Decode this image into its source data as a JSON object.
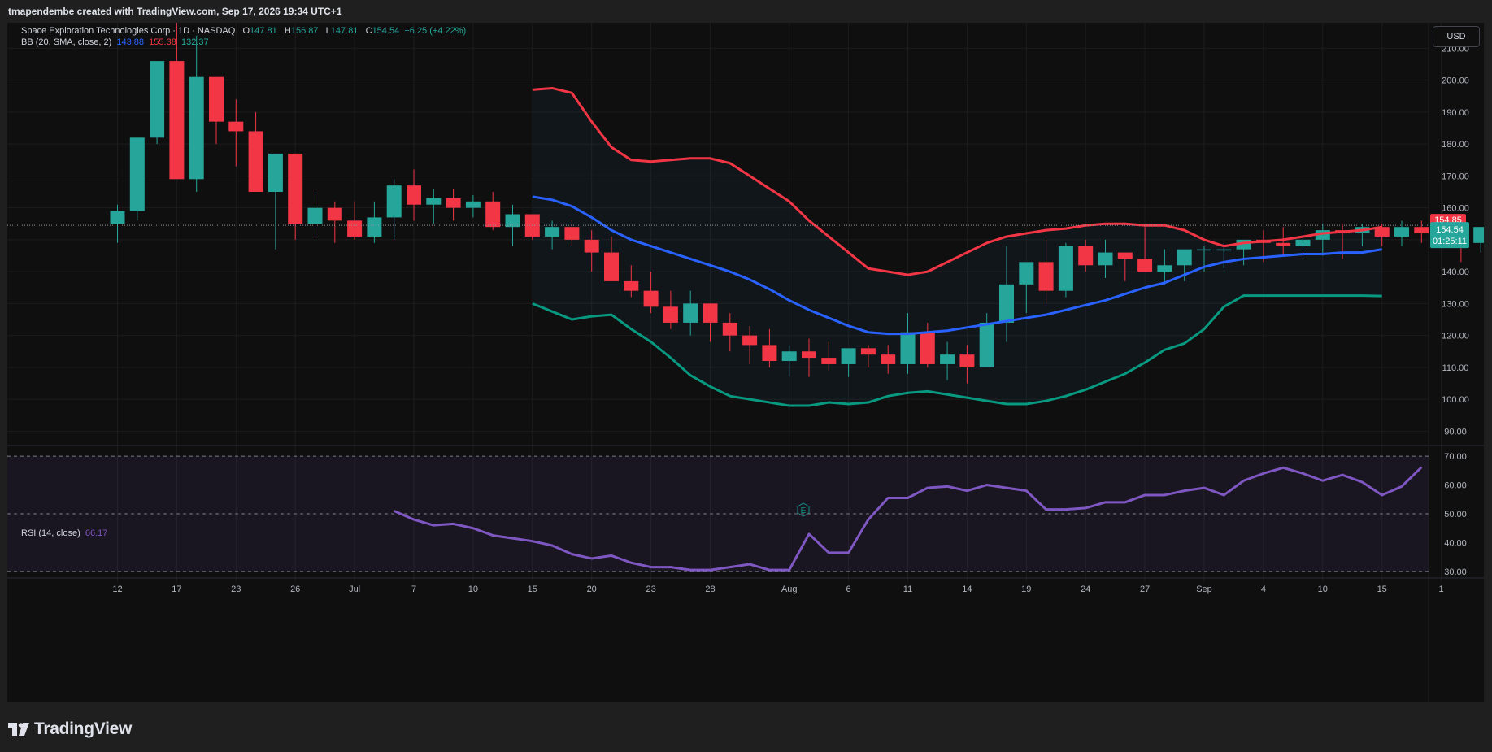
{
  "header": {
    "credit": "tmapendembe created with TradingView.com, Sep 17, 2026 19:34 UTC+1"
  },
  "legend": {
    "symbol": "Space Exploration Technologies Corp · 1D · NASDAQ",
    "o_label": "O",
    "o": "147.81",
    "h_label": "H",
    "h": "156.87",
    "l_label": "L",
    "l": "147.81",
    "c_label": "C",
    "c": "154.54",
    "change": "+6.25 (+4.22%)",
    "bb_label": "BB (20, SMA, close, 2)",
    "bb_basis": "143.88",
    "bb_upper": "155.38",
    "bb_lower": "132.37",
    "rsi_label": "RSI (14, close)",
    "rsi_value": "66.17"
  },
  "currency_button": "USD",
  "footer": {
    "brand": "TradingView",
    "logo_icon": "tradingview-logo-icon"
  },
  "colors": {
    "up": "#26a69a",
    "down": "#f23645",
    "bb_basis": "#2962ff",
    "bb_upper": "#f23645",
    "bb_lower": "#089981",
    "rsi": "#7e57c2"
  },
  "price_tags": {
    "upper": "154.85",
    "last": "154.54",
    "countdown": "01:25:11"
  },
  "earnings_marker": "E",
  "chart_data": [
    {
      "type": "candlestick",
      "title": "Space Exploration Technologies Corp · 1D · NASDAQ",
      "ylim": [
        85,
        218
      ],
      "y_ticks": [
        90,
        100,
        110,
        120,
        130,
        140,
        150,
        160,
        170,
        180,
        190,
        200,
        210
      ],
      "y_tick_labels": [
        "90.00",
        "100.00",
        "110.00",
        "120.00",
        "130.00",
        "140.00",
        "150.00",
        "160.00",
        "170.00",
        "180.00",
        "190.00",
        "200.00",
        "210.00"
      ],
      "x_tick_labels": [
        {
          "label": "12",
          "i": 0
        },
        {
          "label": "17",
          "i": 3
        },
        {
          "label": "23",
          "i": 6
        },
        {
          "label": "26",
          "i": 9
        },
        {
          "label": "Jul",
          "i": 12
        },
        {
          "label": "7",
          "i": 15
        },
        {
          "label": "10",
          "i": 18
        },
        {
          "label": "15",
          "i": 21
        },
        {
          "label": "20",
          "i": 24
        },
        {
          "label": "23",
          "i": 27
        },
        {
          "label": "28",
          "i": 30
        },
        {
          "label": "Aug",
          "i": 34
        },
        {
          "label": "6",
          "i": 37
        },
        {
          "label": "11",
          "i": 40
        },
        {
          "label": "14",
          "i": 43
        },
        {
          "label": "19",
          "i": 46
        },
        {
          "label": "24",
          "i": 49
        },
        {
          "label": "27",
          "i": 52
        },
        {
          "label": "Sep",
          "i": 55
        },
        {
          "label": "4",
          "i": 58
        },
        {
          "label": "10",
          "i": 61
        },
        {
          "label": "15",
          "i": 64
        },
        {
          "label": "1",
          "i": 67
        }
      ],
      "candles": [
        [
          155,
          161,
          149,
          159
        ],
        [
          159,
          177,
          156,
          182
        ],
        [
          182,
          193,
          180,
          206
        ],
        [
          206,
          218,
          200,
          169
        ],
        [
          169,
          214,
          165,
          201
        ],
        [
          201,
          201,
          180,
          187
        ],
        [
          187,
          194,
          173,
          184
        ],
        [
          184,
          190,
          170,
          165
        ],
        [
          165,
          176,
          147,
          177
        ],
        [
          177,
          177,
          150,
          155
        ],
        [
          155,
          165,
          151,
          160
        ],
        [
          160,
          162,
          149,
          156
        ],
        [
          156,
          162,
          150,
          151
        ],
        [
          151,
          162,
          149,
          157
        ],
        [
          157,
          169,
          150,
          167
        ],
        [
          167,
          172,
          156,
          161
        ],
        [
          161,
          166,
          155,
          163
        ],
        [
          163,
          166,
          156,
          160
        ],
        [
          160,
          164,
          157,
          162
        ],
        [
          162,
          165,
          153,
          154
        ],
        [
          154,
          161,
          148,
          158
        ],
        [
          158,
          158,
          150,
          151
        ],
        [
          151,
          156,
          147,
          154
        ],
        [
          154,
          156,
          148,
          150
        ],
        [
          150,
          153,
          140,
          146
        ],
        [
          146,
          151,
          137,
          137
        ],
        [
          137,
          142,
          132,
          134
        ],
        [
          134,
          140,
          127,
          129
        ],
        [
          129,
          134,
          122,
          124
        ],
        [
          124,
          134,
          120,
          130
        ],
        [
          130,
          130,
          118,
          124
        ],
        [
          124,
          127,
          115,
          120
        ],
        [
          120,
          123,
          111,
          117
        ],
        [
          117,
          122,
          110,
          112
        ],
        [
          112,
          117,
          107,
          115
        ],
        [
          115,
          119,
          107,
          113
        ],
        [
          113,
          118,
          109,
          111
        ],
        [
          111,
          115,
          107,
          116
        ],
        [
          116,
          117,
          110,
          114
        ],
        [
          114,
          117,
          108,
          111
        ],
        [
          111,
          127,
          108,
          121
        ],
        [
          121,
          124,
          110,
          111
        ],
        [
          111,
          118,
          106,
          114
        ],
        [
          114,
          117,
          105,
          110
        ],
        [
          110,
          127,
          110,
          124
        ],
        [
          124,
          148,
          118,
          136
        ],
        [
          136,
          138,
          127,
          143
        ],
        [
          143,
          150,
          130,
          134
        ],
        [
          134,
          149,
          132,
          148
        ],
        [
          148,
          150,
          140,
          142
        ],
        [
          142,
          150,
          138,
          146
        ],
        [
          146,
          146,
          137,
          144
        ],
        [
          144,
          154,
          140,
          140
        ],
        [
          140,
          147,
          136,
          142
        ],
        [
          142,
          146,
          137,
          147
        ],
        [
          147,
          148,
          140,
          147
        ],
        [
          147,
          149,
          141,
          147
        ],
        [
          147,
          150,
          142,
          150
        ],
        [
          150,
          153,
          143,
          149
        ],
        [
          149,
          154,
          145,
          148
        ],
        [
          148,
          153,
          144,
          150
        ],
        [
          150,
          155,
          145,
          153
        ],
        [
          153,
          155,
          144,
          152
        ],
        [
          152,
          155,
          148,
          154
        ],
        [
          154,
          155,
          148,
          151
        ],
        [
          151,
          156,
          148,
          154
        ],
        [
          154,
          156,
          149,
          152
        ],
        [
          152,
          156,
          148,
          152
        ],
        [
          152,
          155,
          143,
          149
        ],
        [
          149,
          154,
          146,
          154
        ],
        [
          147.81,
          156.87,
          147.81,
          154.54
        ]
      ],
      "bb_start_index": 21,
      "bb_upper": [
        197,
        197.5,
        196,
        187,
        179,
        175,
        174.5,
        175,
        175.5,
        175.5,
        174,
        170,
        166,
        162,
        156,
        151,
        146,
        141,
        140,
        139,
        140,
        143,
        146,
        149,
        151,
        152,
        153,
        153.5,
        154.5,
        155,
        155,
        154.5,
        154.5,
        153,
        150,
        148,
        149,
        149.5,
        150,
        151,
        152,
        152.5,
        153,
        154
      ],
      "bb_basis": [
        163.5,
        162.5,
        160.5,
        157,
        153,
        150,
        148,
        146,
        144,
        142,
        140,
        137.5,
        134.5,
        131,
        128,
        125.5,
        123,
        121,
        120.5,
        120.5,
        121,
        121.5,
        122.5,
        123.5,
        124.5,
        125.5,
        126.5,
        128,
        129.5,
        131,
        133,
        135,
        136.5,
        139,
        141.5,
        143,
        144,
        144.5,
        145,
        145.5,
        145.5,
        146,
        146,
        147
      ],
      "bb_lower": [
        130,
        127.5,
        125,
        126,
        126.5,
        122,
        118,
        113,
        107.5,
        104,
        101,
        100,
        99,
        98,
        98,
        99,
        98.5,
        99,
        101,
        102,
        102.5,
        101.5,
        100.5,
        99.5,
        98.5,
        98.5,
        99.5,
        101,
        103,
        105.5,
        108,
        111.5,
        115.5,
        117.5,
        122,
        129,
        132.5,
        132.5,
        132.5,
        132.5,
        132.5,
        132.5,
        132.5,
        132.37
      ]
    },
    {
      "type": "line",
      "title": "RSI (14, close)",
      "ylim": [
        28,
        72
      ],
      "y_ticks": [
        30,
        40,
        50,
        60,
        70
      ],
      "y_tick_labels": [
        "30.00",
        "40.00",
        "50.00",
        "60.00",
        "70.00"
      ],
      "band": [
        30,
        70
      ],
      "rsi_start_index": 14,
      "rsi": [
        51,
        48,
        46,
        46.5,
        45,
        42.5,
        41.5,
        40.5,
        39,
        36,
        34.5,
        35.5,
        33,
        31.5,
        31.5,
        30.5,
        30.5,
        31.5,
        32.5,
        30.5,
        30.5,
        43,
        36.5,
        36.5,
        48,
        55.5,
        55.5,
        59,
        59.5,
        58,
        60,
        59,
        58,
        51.5,
        51.5,
        52,
        54,
        54,
        56.5,
        56.5,
        58,
        59,
        56.5,
        61.5,
        64,
        66,
        64,
        61.5,
        63.5,
        61,
        56.5,
        59.5,
        66.17
      ]
    }
  ]
}
